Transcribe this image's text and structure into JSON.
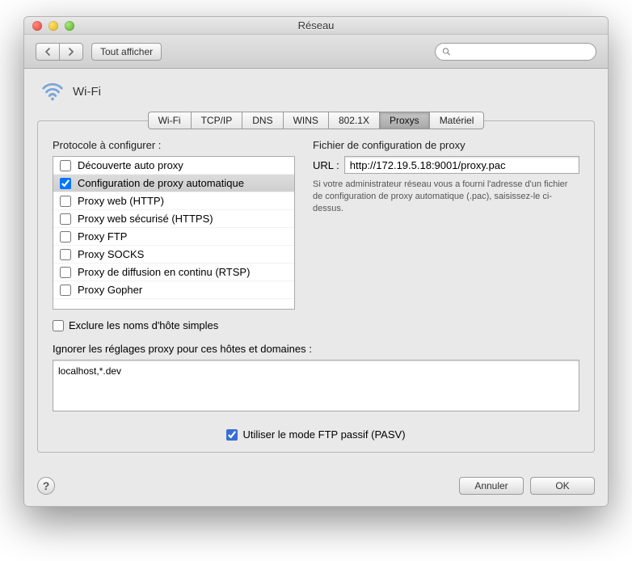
{
  "window": {
    "title": "Réseau"
  },
  "toolbar": {
    "show_all": "Tout afficher",
    "search_placeholder": ""
  },
  "header": {
    "section": "Wi-Fi"
  },
  "tabs": [
    {
      "label": "Wi-Fi"
    },
    {
      "label": "TCP/IP"
    },
    {
      "label": "DNS"
    },
    {
      "label": "WINS"
    },
    {
      "label": "802.1X"
    },
    {
      "label": "Proxys",
      "active": true
    },
    {
      "label": "Matériel"
    }
  ],
  "left": {
    "label": "Protocole à configurer :",
    "protocols": [
      {
        "label": "Découverte auto proxy",
        "checked": false,
        "selected": false
      },
      {
        "label": "Configuration de proxy automatique",
        "checked": true,
        "selected": true
      },
      {
        "label": "Proxy web (HTTP)",
        "checked": false,
        "selected": false
      },
      {
        "label": "Proxy web sécurisé (HTTPS)",
        "checked": false,
        "selected": false
      },
      {
        "label": "Proxy FTP",
        "checked": false,
        "selected": false
      },
      {
        "label": "Proxy SOCKS",
        "checked": false,
        "selected": false
      },
      {
        "label": "Proxy de diffusion en continu (RTSP)",
        "checked": false,
        "selected": false
      },
      {
        "label": "Proxy Gopher",
        "checked": false,
        "selected": false
      }
    ],
    "exclude_simple": {
      "label": "Exclure les noms d'hôte simples",
      "checked": false
    }
  },
  "right": {
    "title": "Fichier de configuration de proxy",
    "url_label": "URL :",
    "url_value": "http://172.19.5.18:9001/proxy.pac",
    "hint": "Si votre administrateur réseau vous a fourni l'adresse d'un fichier de configuration de proxy automatique (.pac), saisissez-le ci-dessus."
  },
  "bypass": {
    "label": "Ignorer les réglages proxy pour ces hôtes et domaines :",
    "value": "localhost,*.dev"
  },
  "pasv": {
    "label": "Utiliser le mode FTP passif (PASV)",
    "checked": true
  },
  "footer": {
    "cancel": "Annuler",
    "ok": "OK"
  }
}
